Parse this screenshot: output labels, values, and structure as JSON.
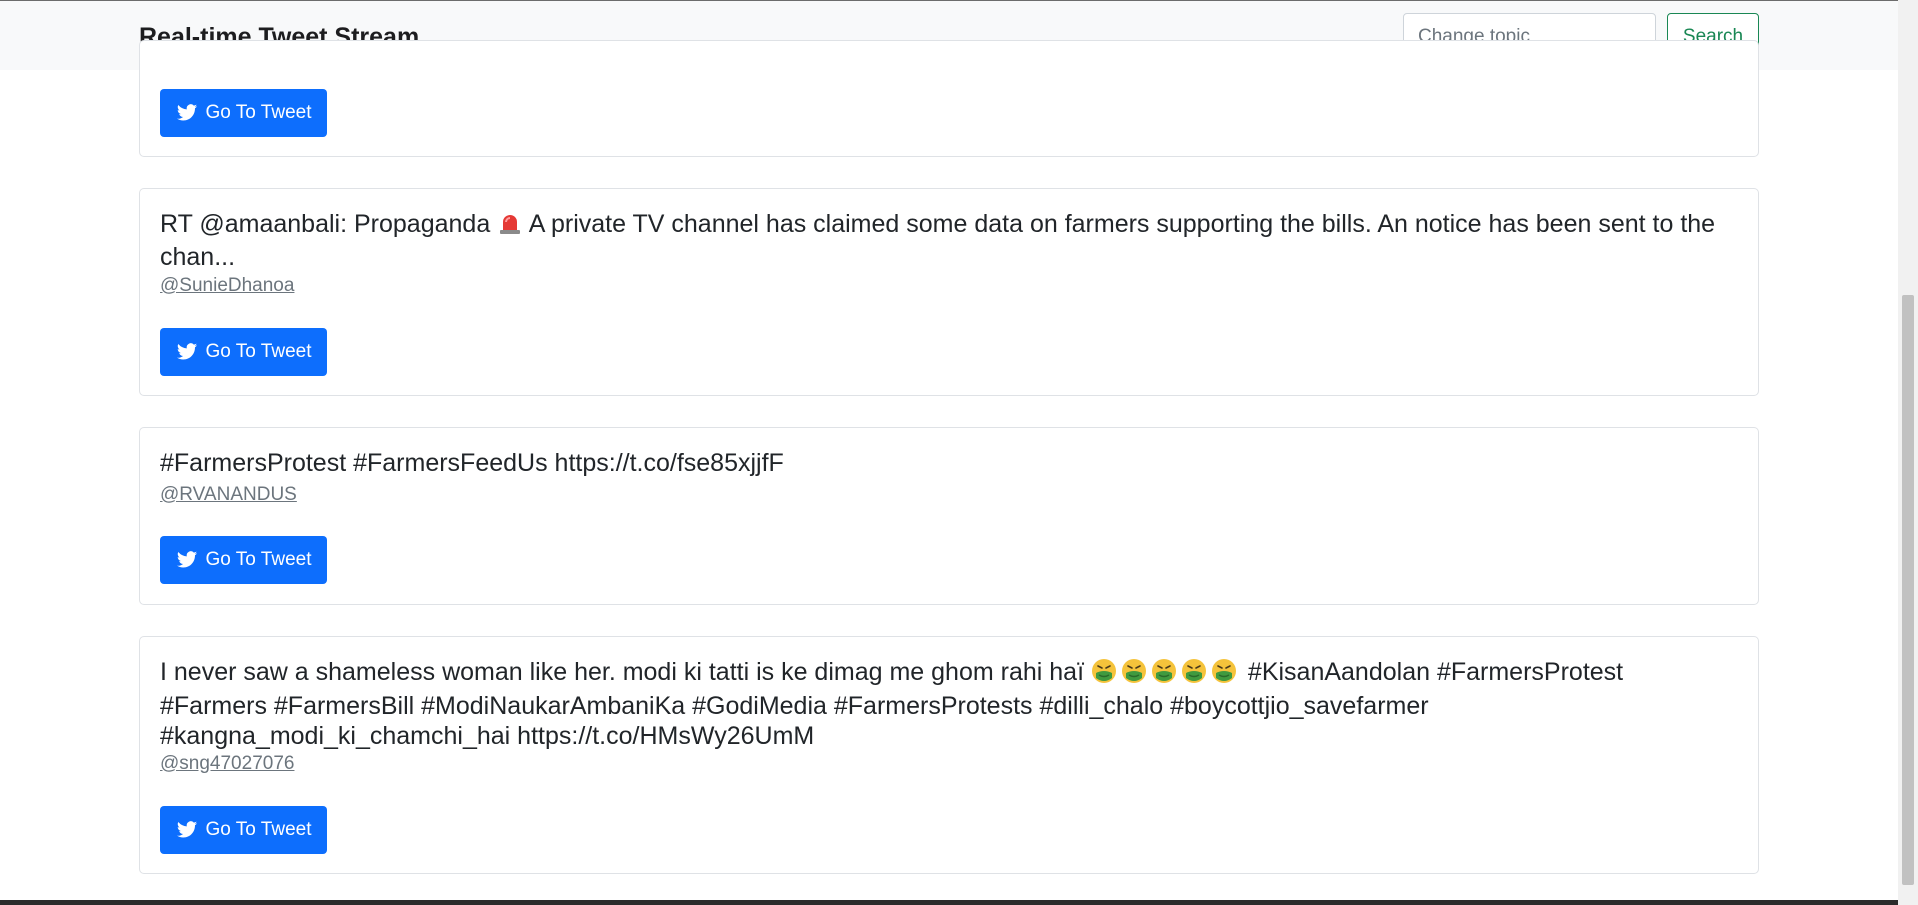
{
  "header": {
    "title": "Real-time Tweet Stream",
    "search_placeholder": "Change topic",
    "search_value": "",
    "search_button": "Search"
  },
  "tweets": [
    {
      "text": "",
      "handle": "",
      "button": "Go To Tweet"
    },
    {
      "text_before_icon": "RT @amaanbali: Propaganda ",
      "icon": "police-light-icon",
      "text_after_icon": " A private TV channel has claimed some data on farmers supporting the bills. An notice has been sent to the chan...",
      "handle": "@SunieDhanoa",
      "button": "Go To Tweet"
    },
    {
      "text": "#FarmersProtest #FarmersFeedUs https://t.co/fse85xjjfF",
      "handle": "@RVANANDUS",
      "button": "Go To Tweet"
    },
    {
      "text_before_icon": "I never saw a shameless woman like her. modi ki tatti is ke dimag me ghom rahi haï ",
      "icon": "nauseated-face-icon",
      "icon_count": 5,
      "text_after_icon": " #KisanAandolan #FarmersProtest #Farmers #FarmersBill #ModiNaukarAmbaniKa #GodiMedia #FarmersProtests #dilli_chalo #boycottjio_savefarmer #kangna_modi_ki_chamchi_hai https://t.co/HMsWy26UmM",
      "handle": "@sng47027076",
      "button": "Go To Tweet"
    }
  ],
  "colors": {
    "primary": "#0d6efd",
    "success": "#198754",
    "muted": "#6c757d",
    "navbar_bg": "#f8f9fa"
  }
}
